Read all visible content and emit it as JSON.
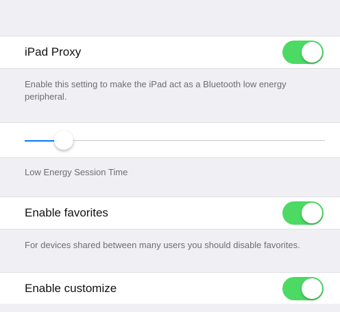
{
  "settings": {
    "ipad_proxy": {
      "label": "iPad Proxy",
      "enabled": true,
      "footer": "Enable this setting to make the iPad act as a Bluetooth low energy peripheral."
    },
    "session_time": {
      "value_fraction": 0.13,
      "footer": "Low Energy Session Time"
    },
    "favorites": {
      "label": "Enable favorites",
      "enabled": true,
      "footer": "For devices shared between many users you should disable favorites."
    },
    "customize": {
      "label": "Enable customize",
      "enabled": true
    }
  },
  "colors": {
    "toggle_on": "#4cd964",
    "slider_fill": "#007aff",
    "background": "#efeff4"
  }
}
